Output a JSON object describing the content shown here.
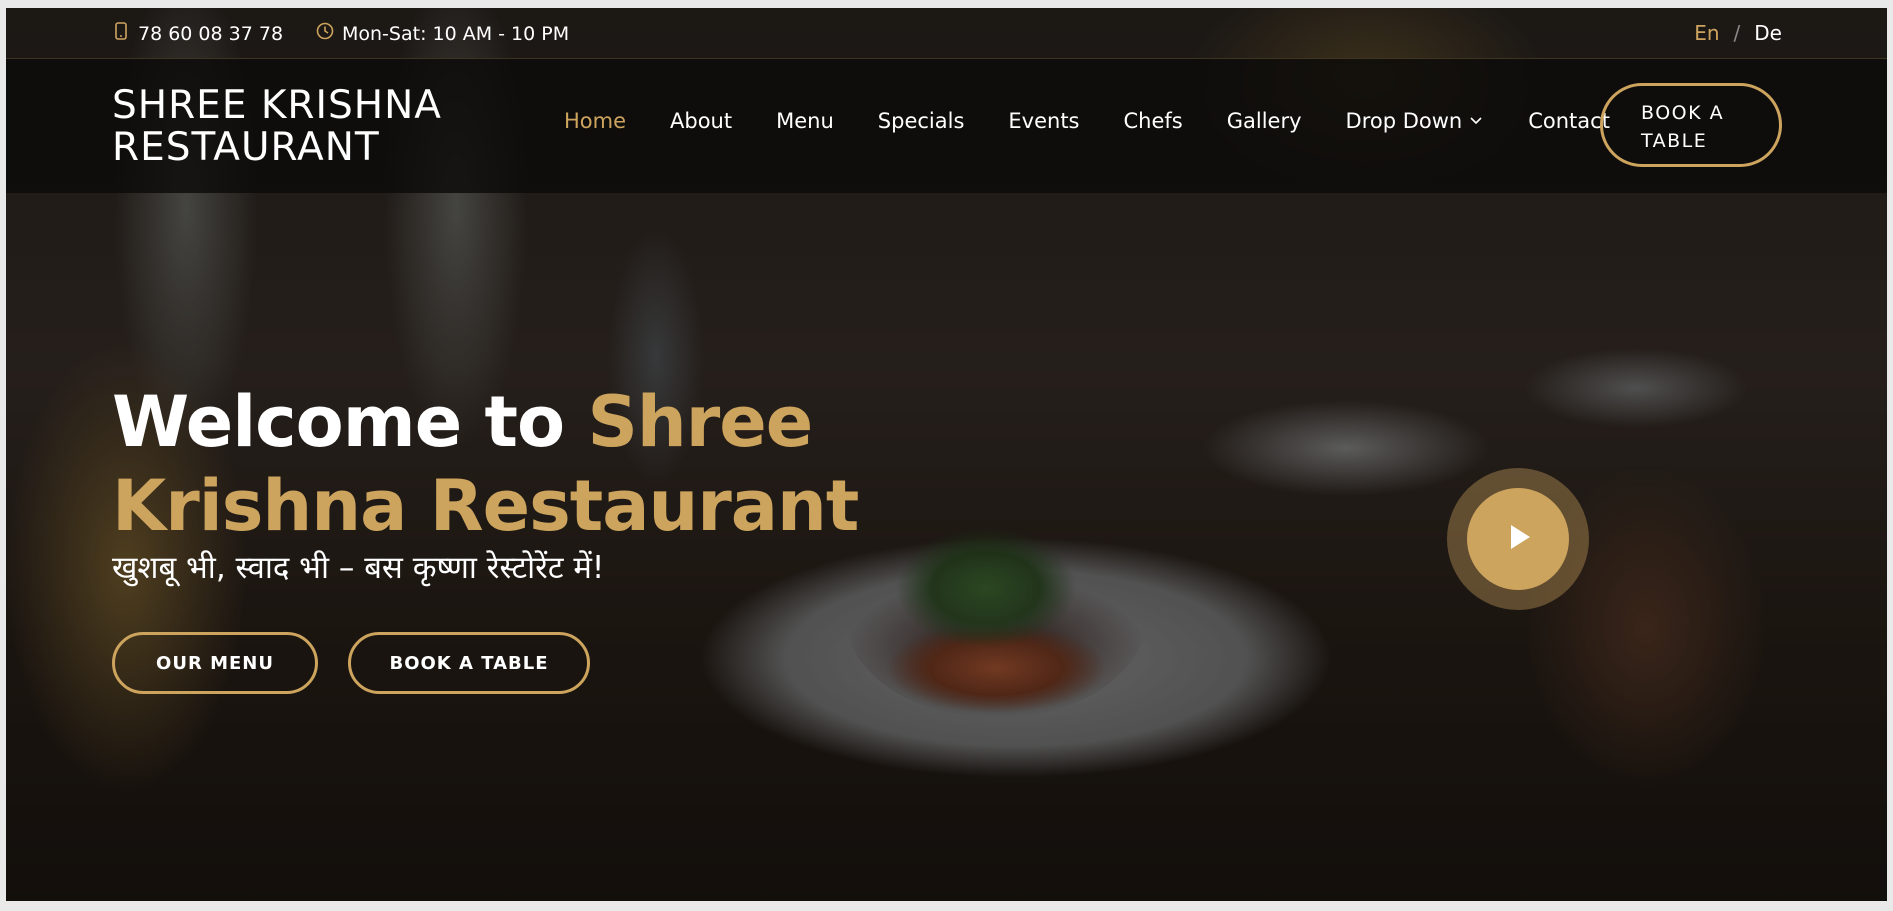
{
  "topbar": {
    "phone": "78 60 08 37 78",
    "hours": "Mon-Sat: 10 AM - 10 PM",
    "languages": [
      "En",
      "De"
    ],
    "lang_separator": "/",
    "active_language": "En"
  },
  "header": {
    "logo_line1": "SHREE KRISHNA",
    "logo_line2": "RESTAURANT",
    "nav": [
      {
        "label": "Home",
        "active": true
      },
      {
        "label": "About"
      },
      {
        "label": "Menu"
      },
      {
        "label": "Specials"
      },
      {
        "label": "Events"
      },
      {
        "label": "Chefs"
      },
      {
        "label": "Gallery"
      },
      {
        "label": "Drop Down",
        "dropdown": true
      },
      {
        "label": "Contact"
      }
    ],
    "book_line1": "BOOK A",
    "book_line2": "TABLE"
  },
  "hero": {
    "title_white": "Welcome to",
    "title_gold": "Shree Krishna Restaurant",
    "subtitle": "खुशबू भी, स्वाद भी – बस कृष्णा रेस्टोरेंट में!",
    "btn_menu": "OUR MENU",
    "btn_book": "BOOK A TABLE"
  },
  "colors": {
    "accent": "#cda45e",
    "header_bg": "#0c0b0a"
  },
  "icons": {
    "phone": "phone-icon",
    "clock": "clock-icon",
    "chevron": "chevron-down-icon",
    "play": "play-icon"
  }
}
